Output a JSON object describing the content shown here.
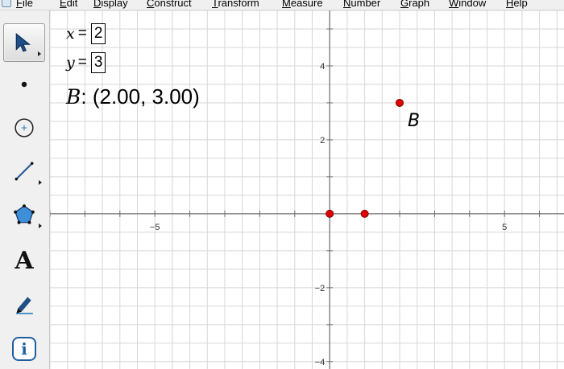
{
  "menu": {
    "items": [
      "File",
      "Edit",
      "Display",
      "Construct",
      "Transform",
      "Measure",
      "Number",
      "Graph",
      "Window",
      "Help"
    ]
  },
  "toolbox": {
    "tools": [
      {
        "name": "arrow-select-tool",
        "icon": "arrow-icon",
        "selected": true,
        "submenu": true
      },
      {
        "name": "point-tool",
        "icon": "point-icon",
        "selected": false,
        "submenu": false
      },
      {
        "name": "compass-tool",
        "icon": "circle-icon",
        "selected": false,
        "submenu": false
      },
      {
        "name": "straightedge-tool",
        "icon": "line-segment-icon",
        "selected": false,
        "submenu": true
      },
      {
        "name": "polygon-tool",
        "icon": "polygon-icon",
        "selected": false,
        "submenu": true
      },
      {
        "name": "text-tool",
        "icon": "text-icon",
        "selected": false,
        "submenu": false
      },
      {
        "name": "marker-tool",
        "icon": "marker-pen-icon",
        "selected": false,
        "submenu": false
      },
      {
        "name": "information-tool",
        "icon": "info-icon",
        "selected": false,
        "submenu": false
      }
    ],
    "text_tool_glyph": "A",
    "info_tool_glyph": "i"
  },
  "parameters": {
    "x": {
      "name": "x",
      "equals": "=",
      "value": "2"
    },
    "y": {
      "name": "y",
      "equals": "=",
      "value": "3"
    }
  },
  "measurement": {
    "point_name": "B",
    "text": ": (2.00, 3.00)"
  },
  "graph": {
    "x_range": [
      -8,
      6.7
    ],
    "y_range": [
      -4.2,
      5.5
    ],
    "grid": true,
    "axis_tick_labels": {
      "x": [
        {
          "value": -5,
          "label": "−5"
        },
        {
          "value": 5,
          "label": "5"
        }
      ],
      "y": [
        {
          "value": 4,
          "label": "4"
        },
        {
          "value": 2,
          "label": "2"
        },
        {
          "value": -2,
          "label": "−2"
        },
        {
          "value": -4,
          "label": "−4"
        }
      ]
    },
    "points": [
      {
        "name": "origin-point",
        "x": 0,
        "y": 0,
        "label": ""
      },
      {
        "name": "unit-point",
        "x": 1,
        "y": 0,
        "label": ""
      },
      {
        "name": "point-b",
        "x": 2,
        "y": 3,
        "label": "B"
      }
    ],
    "colors": {
      "grid": "#d7d7d7",
      "axis": "#6e6e6e",
      "point_fill": "#e00000",
      "point_stroke": "#7a0000"
    }
  }
}
